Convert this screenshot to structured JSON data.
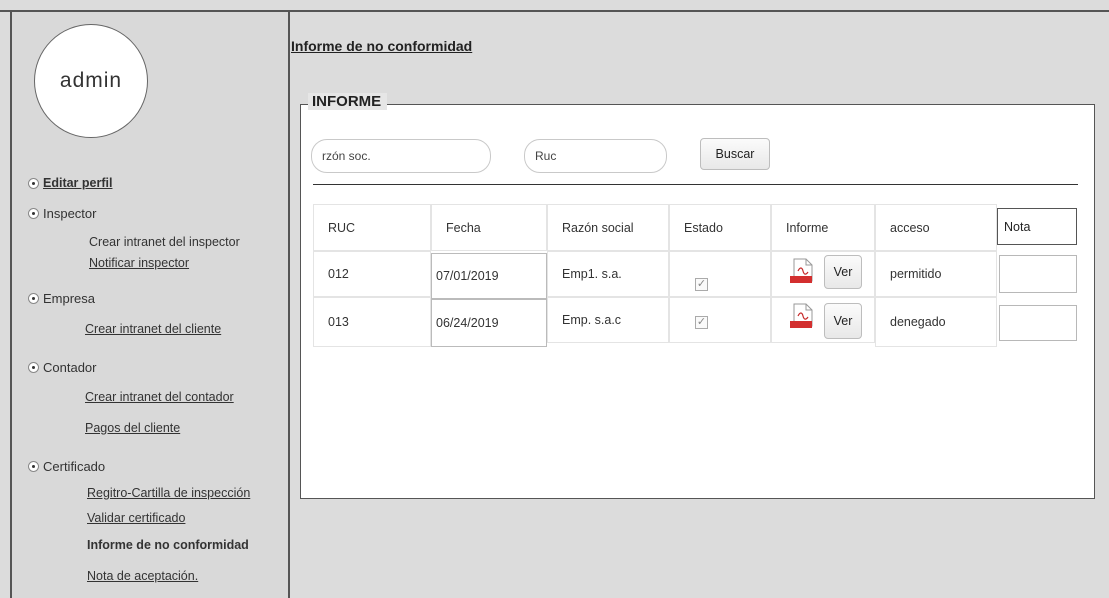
{
  "sidebar": {
    "avatar_label": "admin",
    "edit_profile": "Editar perfil",
    "inspector": {
      "title": "Inspector",
      "items": [
        "Crear intranet del inspector",
        "Notificar inspector"
      ]
    },
    "empresa": {
      "title": "Empresa",
      "items": [
        "Crear intranet del cliente"
      ]
    },
    "contador": {
      "title": "Contador",
      "items": [
        "Crear intranet del contador",
        "Pagos del cliente"
      ]
    },
    "certificado": {
      "title": "Certificado",
      "items": [
        "Regitro-Cartilla de inspección",
        "Validar certificado",
        "Informe de no conformidad",
        "Nota de aceptación."
      ]
    }
  },
  "main": {
    "title": "Informe de no conformidad",
    "legend": "INFORME",
    "search": {
      "razon_placeholder": "rzón soc.",
      "ruc_placeholder": "Ruc",
      "button": "Buscar"
    },
    "table": {
      "headers": [
        "RUC",
        "Fecha",
        "Razón social",
        "Estado",
        "Informe",
        "acceso",
        "Nota"
      ],
      "rows": [
        {
          "ruc": "012",
          "fecha": "07/01/2019",
          "razon": "Emp1. s.a.",
          "estado_checked": true,
          "informe_btn": "Ver",
          "acceso": "permitido",
          "nota": ""
        },
        {
          "ruc": "013",
          "fecha": "06/24/2019",
          "razon": "Emp. s.a.c",
          "estado_checked": true,
          "informe_btn": "Ver",
          "acceso": "denegado",
          "nota": ""
        }
      ]
    },
    "pdf_icon_label": "PDF"
  }
}
